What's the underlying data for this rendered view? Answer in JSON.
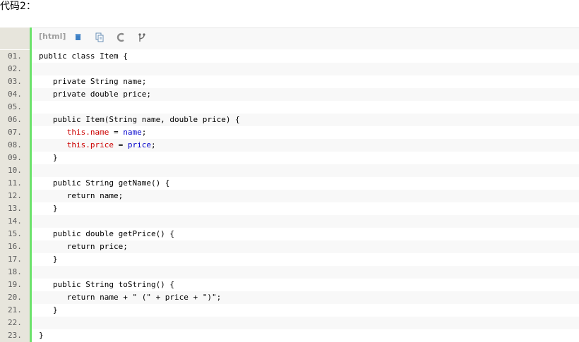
{
  "heading": "代码2：",
  "toolbar": {
    "label": "[html]",
    "icons": [
      "view-source-icon",
      "copy-icon",
      "print-icon",
      "fork-icon"
    ]
  },
  "colors": {
    "gutter": "#e7e5dc",
    "accent_bar": "#6ce26c",
    "alt_row": "#f8f8f8",
    "keyword_this": "#cc0000",
    "variable": "#0000cc"
  },
  "code_lines": [
    {
      "num": "01.",
      "segments": [
        {
          "t": "public class Item {",
          "c": ""
        }
      ]
    },
    {
      "num": "02.",
      "segments": [
        {
          "t": "",
          "c": ""
        }
      ]
    },
    {
      "num": "03.",
      "segments": [
        {
          "t": "   private String name;",
          "c": ""
        }
      ]
    },
    {
      "num": "04.",
      "segments": [
        {
          "t": "   private double price;",
          "c": ""
        }
      ]
    },
    {
      "num": "05.",
      "segments": [
        {
          "t": "",
          "c": ""
        }
      ]
    },
    {
      "num": "06.",
      "segments": [
        {
          "t": "   public Item(String name, double price) {",
          "c": ""
        }
      ]
    },
    {
      "num": "07.",
      "segments": [
        {
          "t": "      ",
          "c": ""
        },
        {
          "t": "this.name",
          "c": "kw"
        },
        {
          "t": " = ",
          "c": ""
        },
        {
          "t": "name",
          "c": "var"
        },
        {
          "t": ";",
          "c": ""
        }
      ]
    },
    {
      "num": "08.",
      "segments": [
        {
          "t": "      ",
          "c": ""
        },
        {
          "t": "this.price",
          "c": "kw"
        },
        {
          "t": " = ",
          "c": ""
        },
        {
          "t": "price",
          "c": "var"
        },
        {
          "t": ";",
          "c": ""
        }
      ]
    },
    {
      "num": "09.",
      "segments": [
        {
          "t": "   }",
          "c": ""
        }
      ]
    },
    {
      "num": "10.",
      "segments": [
        {
          "t": "",
          "c": ""
        }
      ]
    },
    {
      "num": "11.",
      "segments": [
        {
          "t": "   public String getName() {",
          "c": ""
        }
      ]
    },
    {
      "num": "12.",
      "segments": [
        {
          "t": "      return name;",
          "c": ""
        }
      ]
    },
    {
      "num": "13.",
      "segments": [
        {
          "t": "   }",
          "c": ""
        }
      ]
    },
    {
      "num": "14.",
      "segments": [
        {
          "t": "",
          "c": ""
        }
      ]
    },
    {
      "num": "15.",
      "segments": [
        {
          "t": "   public double getPrice() {",
          "c": ""
        }
      ]
    },
    {
      "num": "16.",
      "segments": [
        {
          "t": "      return price;",
          "c": ""
        }
      ]
    },
    {
      "num": "17.",
      "segments": [
        {
          "t": "   }",
          "c": ""
        }
      ]
    },
    {
      "num": "18.",
      "segments": [
        {
          "t": "",
          "c": ""
        }
      ]
    },
    {
      "num": "19.",
      "segments": [
        {
          "t": "   public String toString() {",
          "c": ""
        }
      ]
    },
    {
      "num": "20.",
      "segments": [
        {
          "t": "      return name + \" (\" + price + \")\";",
          "c": ""
        }
      ]
    },
    {
      "num": "21.",
      "segments": [
        {
          "t": "   }",
          "c": ""
        }
      ]
    },
    {
      "num": "22.",
      "segments": [
        {
          "t": "",
          "c": ""
        }
      ]
    },
    {
      "num": "23.",
      "segments": [
        {
          "t": "}",
          "c": ""
        }
      ]
    }
  ]
}
